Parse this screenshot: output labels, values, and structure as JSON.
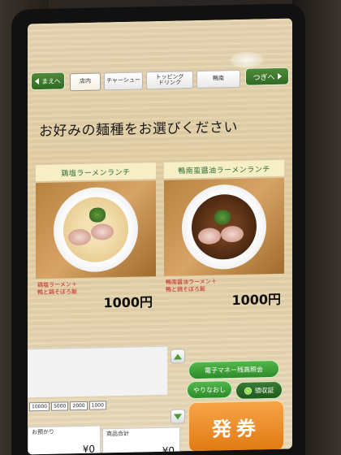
{
  "nav": {
    "prev_label": "まえへ",
    "next_label": "つぎへ",
    "tabs": [
      {
        "label": "店内"
      },
      {
        "label": "チャーシュー"
      },
      {
        "label": "トッピング\nドリンク"
      },
      {
        "label": "鴨南"
      }
    ]
  },
  "heading": "お好みの麺種をお選びください",
  "menu": [
    {
      "title": "鶏塩ラーメンランチ",
      "note_line1": "鶏塩ラーメン＋",
      "note_line2": "鴨と鶏そぼろ飯",
      "price": "1000円"
    },
    {
      "title": "鴨南蛮醤油ラーメンランチ",
      "note_line1": "鴨南醤油ラーメン＋",
      "note_line2": "鴨と鶏そぼろ飯",
      "price": "1000円"
    }
  ],
  "payment": {
    "denominations": [
      "10000",
      "5000",
      "2000",
      "1000"
    ],
    "paid_label": "お預かり",
    "paid_value": "¥0",
    "total_label": "商品合計",
    "total_value": "¥0",
    "emoney_label": "電子マネー残高照会",
    "reset_label": "やりなおし",
    "receipt_label": "領収証",
    "issue_label": "発券"
  }
}
